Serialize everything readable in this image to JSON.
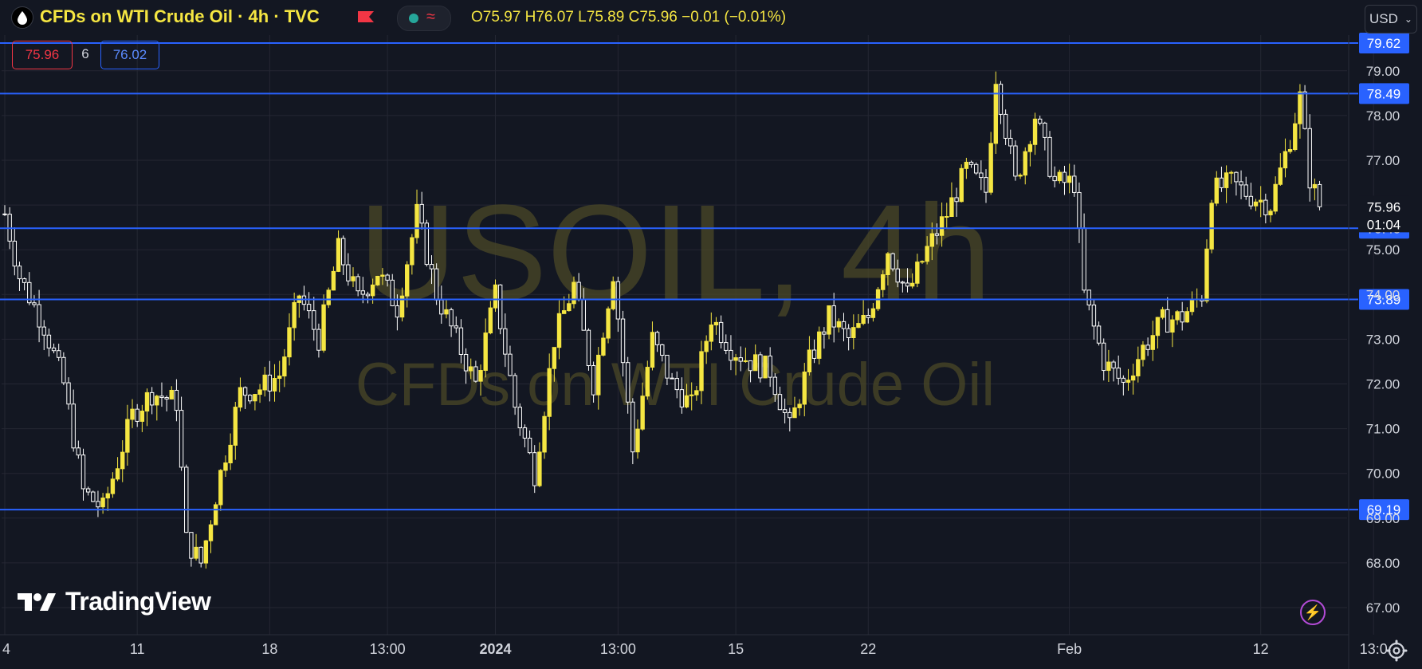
{
  "header": {
    "title": "CFDs on WTI Crude Oil · 4h · TVC",
    "ohlc": [
      {
        "label": "O",
        "value": "75.97"
      },
      {
        "label": "H",
        "value": "76.07"
      },
      {
        "label": "L",
        "value": "75.89"
      },
      {
        "label": "C",
        "value": "75.96"
      }
    ],
    "change": "−0.01 (−0.01%)",
    "currency": "USD"
  },
  "quote": {
    "bid": "75.96",
    "spread": "6",
    "ask": "76.02"
  },
  "logo": {
    "text": "TradingView"
  },
  "colors": {
    "background": "#131722",
    "up_candle": "#f5e642",
    "down_candle": "#ffffff",
    "level_line": "#2962ff",
    "watermark": "#4a4726"
  },
  "chart_data": {
    "type": "candlestick",
    "symbol": "USOIL",
    "timeframe": "4h",
    "watermark": {
      "symbol": "USOIL, 4h",
      "name": "CFDs on WTI Crude Oil"
    },
    "ylim": [
      66.5,
      79.8
    ],
    "y_ticks": [
      "67.00",
      "68.00",
      "69.00",
      "70.00",
      "71.00",
      "72.00",
      "73.00",
      "74.00",
      "75.00",
      "76.00",
      "77.00",
      "78.00",
      "79.00"
    ],
    "x_ticks": [
      {
        "label": "4",
        "idx": 0
      },
      {
        "label": "11",
        "idx": 27
      },
      {
        "label": "18",
        "idx": 54
      },
      {
        "label": "13:00",
        "idx": 78
      },
      {
        "label": "2024",
        "idx": 100,
        "bold": true
      },
      {
        "label": "13:00",
        "idx": 125
      },
      {
        "label": "15",
        "idx": 149
      },
      {
        "label": "22",
        "idx": 176
      },
      {
        "label": "Feb",
        "idx": 217
      },
      {
        "label": "12",
        "idx": 256
      },
      {
        "label": "13:0",
        "idx": 279
      }
    ],
    "levels": [
      {
        "value": 79.62,
        "label": "79.62"
      },
      {
        "value": 78.49,
        "label": "78.49"
      },
      {
        "value": 75.48,
        "label": "75.48"
      },
      {
        "value": 73.89,
        "label": "73.89"
      },
      {
        "value": 69.19,
        "label": "69.19"
      }
    ],
    "last_price": {
      "value": 75.96,
      "label": "75.96",
      "countdown": "01:04"
    },
    "keypoints": [
      [
        0,
        75.8
      ],
      [
        3,
        74.4
      ],
      [
        8,
        73.3
      ],
      [
        12,
        72.0
      ],
      [
        16,
        69.6
      ],
      [
        20,
        69.2
      ],
      [
        26,
        71.3
      ],
      [
        30,
        71.8
      ],
      [
        35,
        71.6
      ],
      [
        37,
        68.5
      ],
      [
        40,
        68.0
      ],
      [
        44,
        70.0
      ],
      [
        48,
        71.8
      ],
      [
        52,
        71.9
      ],
      [
        56,
        72.2
      ],
      [
        60,
        74.0
      ],
      [
        64,
        73.0
      ],
      [
        68,
        75.0
      ],
      [
        72,
        73.9
      ],
      [
        76,
        74.5
      ],
      [
        80,
        73.7
      ],
      [
        84,
        75.8
      ],
      [
        88,
        74.0
      ],
      [
        92,
        73.0
      ],
      [
        96,
        72.0
      ],
      [
        100,
        74.0
      ],
      [
        104,
        71.5
      ],
      [
        108,
        70.0
      ],
      [
        112,
        73.0
      ],
      [
        116,
        74.2
      ],
      [
        120,
        72.0
      ],
      [
        124,
        74.5
      ],
      [
        128,
        70.5
      ],
      [
        132,
        73.0
      ],
      [
        136,
        72.0
      ],
      [
        140,
        71.5
      ],
      [
        144,
        73.5
      ],
      [
        148,
        72.8
      ],
      [
        152,
        72.5
      ],
      [
        156,
        72.3
      ],
      [
        160,
        71.0
      ],
      [
        164,
        72.5
      ],
      [
        168,
        73.5
      ],
      [
        172,
        73.0
      ],
      [
        176,
        73.5
      ],
      [
        180,
        75.0
      ],
      [
        184,
        74.0
      ],
      [
        188,
        75.0
      ],
      [
        192,
        75.8
      ],
      [
        196,
        76.8
      ],
      [
        200,
        76.3
      ],
      [
        202,
        78.9
      ],
      [
        206,
        76.5
      ],
      [
        210,
        78.0
      ],
      [
        214,
        76.5
      ],
      [
        218,
        76.5
      ],
      [
        220,
        74.0
      ],
      [
        224,
        72.5
      ],
      [
        228,
        72.0
      ],
      [
        232,
        72.8
      ],
      [
        236,
        73.4
      ],
      [
        240,
        73.5
      ],
      [
        244,
        74.0
      ],
      [
        246,
        76.3
      ],
      [
        250,
        76.5
      ],
      [
        254,
        76.2
      ],
      [
        258,
        76.0
      ],
      [
        262,
        77.5
      ],
      [
        264,
        78.4
      ],
      [
        266,
        76.6
      ],
      [
        268,
        75.96
      ]
    ]
  }
}
